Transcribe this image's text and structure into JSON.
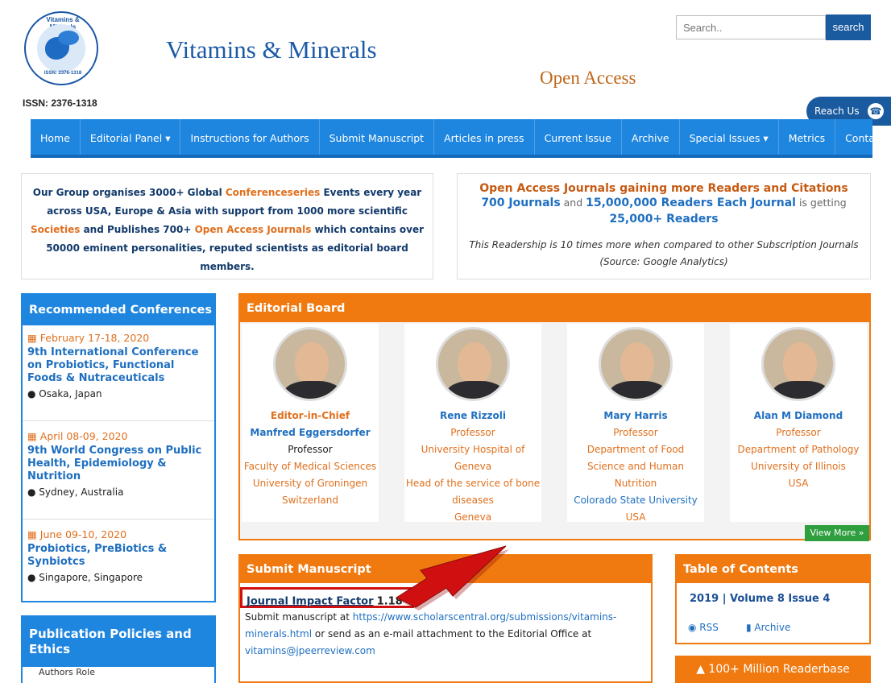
{
  "header": {
    "logo_text": "Vitamins & Minerals",
    "logo_issn": "ISSN: 2376-1318",
    "site_title": "Vitamins & Minerals",
    "subtitle": "Open Access",
    "issn": "ISSN: 2376-1318",
    "search_placeholder": "Search..",
    "search_button": "search",
    "reach_us": "Reach Us"
  },
  "nav": {
    "items": [
      "Home",
      "Editorial Panel ▾",
      "Instructions for Authors",
      "Submit Manuscript",
      "Articles in press",
      "Current Issue",
      "Archive",
      "Special Issues ▾",
      "Metrics",
      "Contact"
    ]
  },
  "info_left": {
    "p1": "Our Group organises 3000+ Global ",
    "l1": "Conferenceseries",
    "p2": " Events every year across USA, Europe & Asia with support from 1000 more scientific ",
    "l2": "Societies",
    "p3": " and Publishes 700+ ",
    "l3": "Open Access Journals",
    "p4": " which contains over 50000 eminent personalities, reputed scientists as editorial board members."
  },
  "info_right": {
    "headline": "Open Access Journals gaining more Readers and Citations",
    "journals": "700 Journals",
    "and": " and ",
    "readers": "15,000,000 Readers Each Journal",
    "getting": " is getting ",
    "readers2": "25,000+ Readers",
    "note": "This Readership is 10 times more when compared to other Subscription Journals (Source: Google Analytics)"
  },
  "conferences": {
    "heading": "Recommended Conferences",
    "items": [
      {
        "date": "February 17-18, 2020",
        "title": "9th International Conference on Probiotics, Functional Foods & Nutraceuticals",
        "location": "Osaka, Japan"
      },
      {
        "date": "April 08-09, 2020",
        "title": "9th World Congress on Public Health, Epidemiology & Nutrition",
        "location": "Sydney, Australia"
      },
      {
        "date": "June 09-10, 2020",
        "title": "Probiotics, PreBiotics & Synbiotcs",
        "location": "Singapore, Singapore"
      }
    ]
  },
  "policies": {
    "heading": "Publication Policies and Ethics",
    "first_item": "Authors Role"
  },
  "editorial_board": {
    "heading": "Editorial Board",
    "members": [
      {
        "role": "Editor-in-Chief",
        "name": "Manfred Eggersdorfer",
        "lines": [
          "Professor",
          "Faculty of Medical Sciences",
          "University of Groningen",
          "Switzerland"
        ]
      },
      {
        "role": "",
        "name": "Rene Rizzoli",
        "lines": [
          "Professor",
          "University Hospital of Geneva",
          "Head of the service of bone diseases",
          "Geneva"
        ]
      },
      {
        "role": "",
        "name": "Mary Harris",
        "lines": [
          "Professor",
          "Department of Food Science and Human Nutrition",
          "Colorado State University",
          "USA"
        ]
      },
      {
        "role": "",
        "name": "Alan M Diamond",
        "lines": [
          "Professor",
          "Department of Pathology",
          "University of Illinois",
          "USA"
        ]
      }
    ],
    "view_more": "View More »"
  },
  "submit": {
    "heading": "Submit Manuscript",
    "jif_label": "Journal Impact Factor",
    "jif_value": "1.18",
    "jif_sup": "*",
    "text1": "Submit manuscript at ",
    "link": "https://www.scholarscentral.org/submissions/vitamins-minerals.html",
    "text2": " or send as an e-mail attachment to the Editorial Office at ",
    "email": "vitamins@jpeerreview.com"
  },
  "toc": {
    "heading": "Table of Contents",
    "volume": "2019 | Volume 8 Issue 4",
    "rss": "RSS",
    "archive": "Archive"
  },
  "readerbase": "100+ Million Readerbase",
  "colors": {
    "nav_blue": "#1f86e0",
    "orange": "#f07a10",
    "annotation_red": "#d01010"
  }
}
